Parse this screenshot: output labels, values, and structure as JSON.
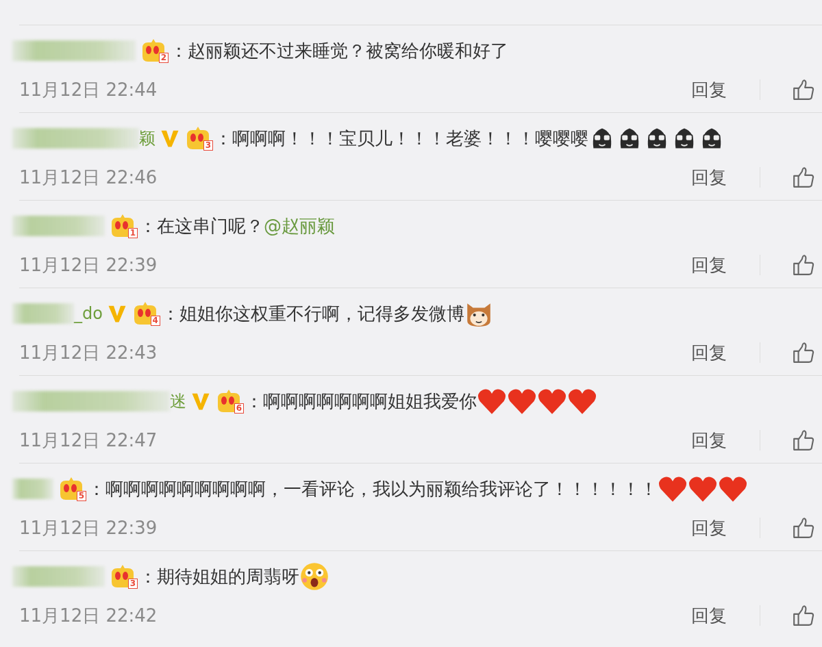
{
  "comments": [
    {
      "verified": false,
      "fan_level": "2",
      "text": "：赵丽颖还不过来睡觉？被窝给你暖和好了",
      "time": "11月12日 22:44",
      "reply": "回复"
    },
    {
      "username_visible": "颖",
      "verified": true,
      "fan_level": "3",
      "text": "：啊啊啊！！！宝贝儿！！！老婆！！！嘤嘤嘤",
      "emojis": [
        {
          "kind": "sunglasses"
        },
        {
          "kind": "sunglasses"
        },
        {
          "kind": "sunglasses"
        },
        {
          "kind": "sunglasses"
        },
        {
          "kind": "sunglasses"
        }
      ],
      "time": "11月12日 22:46",
      "reply": "回复"
    },
    {
      "verified": false,
      "fan_level": "1",
      "text": "：在这串门呢？",
      "mention": "@赵丽颖",
      "time": "11月12日 22:39",
      "reply": "回复"
    },
    {
      "username_visible": "_do",
      "verified": true,
      "fan_level": "4",
      "text": "：姐姐你这权重不行啊，记得多发微博",
      "emojis": [
        {
          "kind": "cat"
        }
      ],
      "time": "11月12日 22:43",
      "reply": "回复"
    },
    {
      "username_visible": "迷",
      "verified": true,
      "fan_level": "6",
      "text": "：啊啊啊啊啊啊啊姐姐我爱你",
      "emojis": [
        {
          "kind": "heart"
        },
        {
          "kind": "heart"
        },
        {
          "kind": "heart"
        },
        {
          "kind": "heart"
        }
      ],
      "time": "11月12日 22:47",
      "reply": "回复"
    },
    {
      "verified": false,
      "fan_level": "5",
      "text": "：啊啊啊啊啊啊啊啊啊，一看评论，我以为丽颖给我评论了！！！！！！",
      "emojis": [
        {
          "kind": "heart"
        },
        {
          "kind": "heart"
        },
        {
          "kind": "heart"
        }
      ],
      "time": "11月12日 22:39",
      "reply": "回复"
    },
    {
      "verified": false,
      "fan_level": "3",
      "text": "：期待姐姐的周翡呀",
      "emojis": [
        {
          "kind": "shocked"
        }
      ],
      "time": "11月12日 22:42",
      "reply": "回复"
    }
  ]
}
